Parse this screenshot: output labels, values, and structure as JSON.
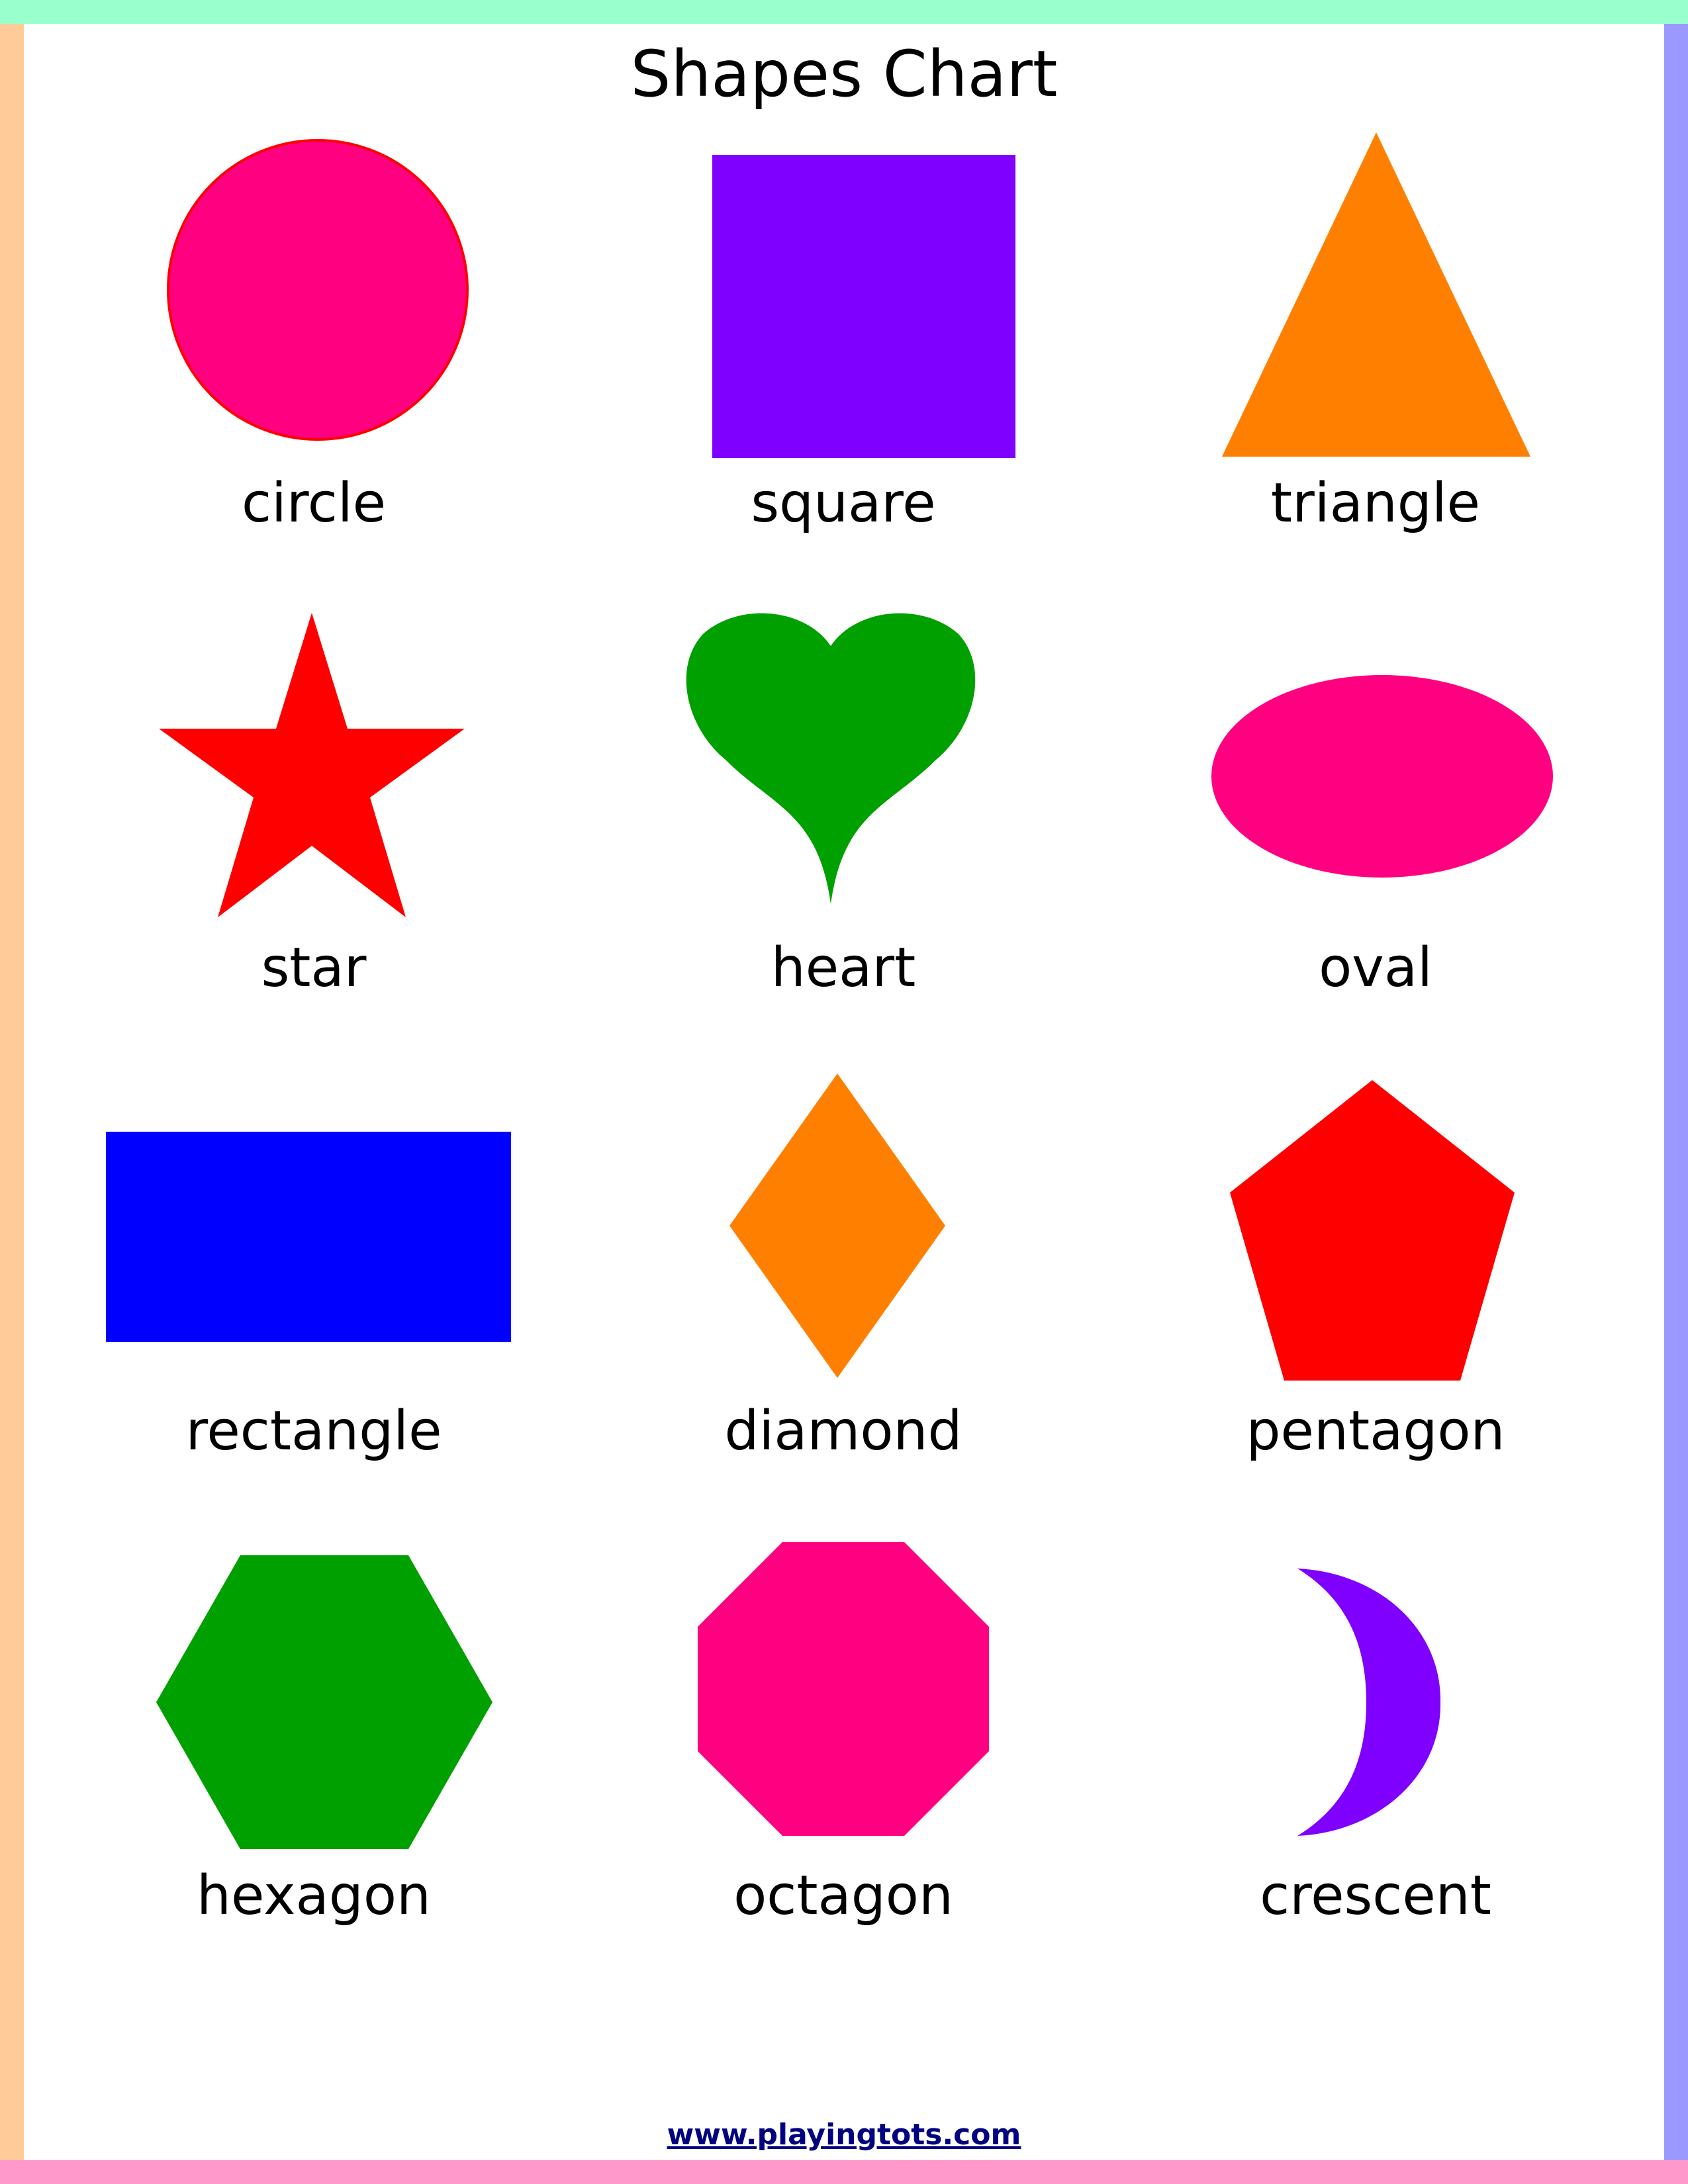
{
  "page": {
    "title": "Shapes Chart",
    "footer_link": "www.playingtots.com"
  },
  "colors": {
    "border_top": "#99ffcc",
    "border_left": "#ffcc99",
    "border_right": "#9999ff",
    "border_bottom": "#ff99cc",
    "pink": "#ff0080",
    "purple": "#8000ff",
    "orange": "#ff8000",
    "red": "#ff0000",
    "green": "#00a000",
    "blue": "#0000ff"
  },
  "shapes": [
    {
      "label": "circle",
      "color": "#ff0080",
      "icon": "circle-shape"
    },
    {
      "label": "square",
      "color": "#8000ff",
      "icon": "square-shape"
    },
    {
      "label": "triangle",
      "color": "#ff8000",
      "icon": "triangle-shape"
    },
    {
      "label": "star",
      "color": "#ff0000",
      "icon": "star-shape"
    },
    {
      "label": "heart",
      "color": "#00a000",
      "icon": "heart-shape"
    },
    {
      "label": "oval",
      "color": "#ff0080",
      "icon": "oval-shape"
    },
    {
      "label": "rectangle",
      "color": "#0000ff",
      "icon": "rectangle-shape"
    },
    {
      "label": "diamond",
      "color": "#ff8000",
      "icon": "diamond-shape"
    },
    {
      "label": "pentagon",
      "color": "#ff0000",
      "icon": "pentagon-shape"
    },
    {
      "label": "hexagon",
      "color": "#00a000",
      "icon": "hexagon-shape"
    },
    {
      "label": "octagon",
      "color": "#ff0080",
      "icon": "octagon-shape"
    },
    {
      "label": "crescent",
      "color": "#8000ff",
      "icon": "crescent-shape"
    }
  ]
}
